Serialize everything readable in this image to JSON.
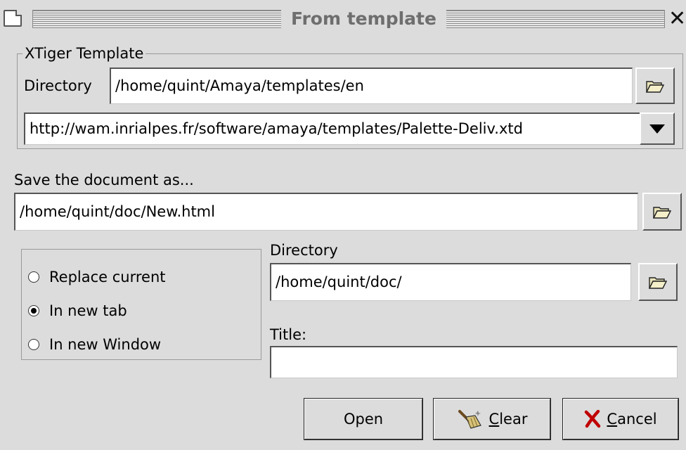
{
  "window": {
    "title": "From template"
  },
  "template_group": {
    "legend": "XTiger Template",
    "directory_label": "Directory",
    "directory_value": "/home/quint/Amaya/templates/en",
    "template_url": "http://wam.inrialpes.fr/software/amaya/templates/Palette-Deliv.xtd"
  },
  "save": {
    "label": "Save the document as...",
    "path_value": "/home/quint/doc/New.html"
  },
  "open_mode": {
    "options": [
      {
        "label": "Replace current",
        "checked": false
      },
      {
        "label": "In new tab",
        "checked": true
      },
      {
        "label": "In new Window",
        "checked": false
      }
    ]
  },
  "output": {
    "directory_label": "Directory",
    "directory_value": "/home/quint/doc/",
    "title_label": "Title:",
    "title_value": ""
  },
  "buttons": {
    "open": "Open",
    "clear_mnemonic": "C",
    "clear_rest": "lear",
    "cancel_mnemonic": "C",
    "cancel_rest": "ancel"
  },
  "icons": {
    "folder": "folder-open-icon",
    "dropdown": "chevron-down-icon",
    "clear": "broom-icon",
    "cancel": "red-x-icon",
    "window": "document-icon",
    "close": "close-icon"
  },
  "colors": {
    "background": "#dcdcdc",
    "title_text": "#6e6e6e",
    "cancel_x": "#c00000"
  }
}
